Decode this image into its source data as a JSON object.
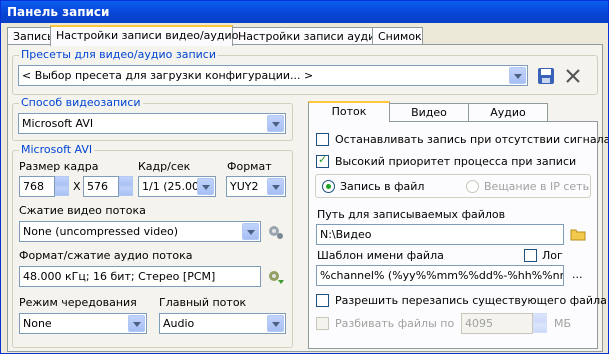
{
  "window": {
    "title": "Панель записи"
  },
  "tabs": [
    "Запись",
    "Настройки записи видео/аудио",
    "Настройки записи аудио",
    "Снимок"
  ],
  "presets": {
    "legend": "Пресеты для видео/аудио записи",
    "value": "< Выбор пресета для загрузки конфигурации... >"
  },
  "method": {
    "legend": "Способ видеозаписи",
    "value": "Microsoft AVI"
  },
  "avi": {
    "legend": "Microsoft AVI",
    "frame_size_label": "Размер кадра",
    "width": "768",
    "x_sep": "X",
    "height": "576",
    "fps_label": "Кадр/сек",
    "fps_value": "1/1 (25.00)",
    "format_label": "Формат",
    "format_value": "YUY2",
    "video_compress_label": "Сжатие видео потока",
    "video_compress_value": "None (uncompressed video)",
    "audio_label": "Формат/сжатие аудио потока",
    "audio_value": "48.000 кГц; 16 бит; Стерео [PCM]",
    "interleave_label": "Режим чередования",
    "interleave_value": "None",
    "master_label": "Главный поток",
    "master_value": "Audio"
  },
  "subtabs": [
    "Поток",
    "Видео",
    "Аудио"
  ],
  "stream": {
    "stop_no_signal": "Останавливать запись при отсутствии сигнала",
    "high_priority": "Высокий приоритет процесса при записи",
    "record_to_file": "Запись в файл",
    "ip_broadcast": "Вещание в IP сеть",
    "path_label": "Путь для записываемых файлов",
    "path_value": "N:\\Видео",
    "template_label": "Шаблон имени файла",
    "log_label": "Лог",
    "template_value": "%channel% (%yy%%mm%%dd%-%hh%%nn%",
    "more_button": "...",
    "allow_overwrite": "Разрешить перезапись существующего файла",
    "split_label": "Разбивать файлы по",
    "split_value": "4095",
    "split_unit": "МБ"
  },
  "checks": {
    "stop_no_signal": false,
    "high_priority": true,
    "log": false,
    "allow_overwrite": false,
    "split": false
  },
  "colors": {
    "accent": "#0046d5",
    "titlebar": "#0a5ff0",
    "tab_highlight": "#ffc83c"
  }
}
